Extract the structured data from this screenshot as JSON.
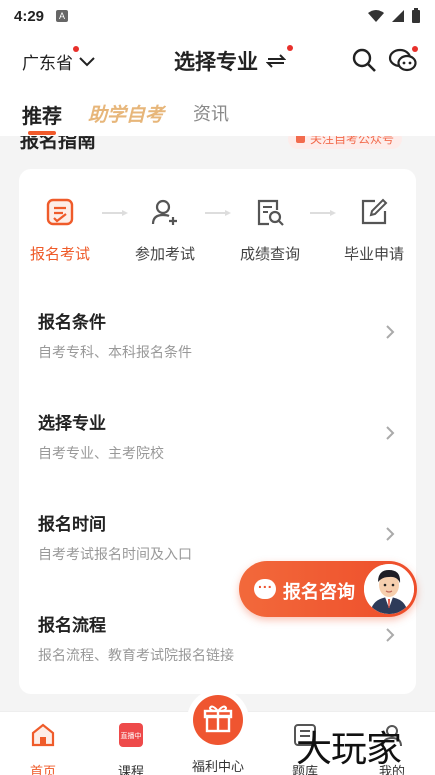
{
  "status_bar": {
    "time": "4:29",
    "badge": "A"
  },
  "header": {
    "province": "广东省",
    "title": "选择专业"
  },
  "tabs": [
    {
      "label": "推荐"
    },
    {
      "label": "助学自考"
    },
    {
      "label": "资讯"
    }
  ],
  "guide": {
    "title": "报名指南",
    "follow_label": "关注自考公众号"
  },
  "steps": [
    {
      "label": "报名考试",
      "icon": "form-check-icon"
    },
    {
      "label": "参加考试",
      "icon": "user-add-icon"
    },
    {
      "label": "成绩查询",
      "icon": "doc-search-icon"
    },
    {
      "label": "毕业申请",
      "icon": "edit-icon"
    }
  ],
  "list": [
    {
      "title": "报名条件",
      "subtitle": "自考专科、本科报名条件"
    },
    {
      "title": "选择专业",
      "subtitle": "自考专业、主考院校"
    },
    {
      "title": "报名时间",
      "subtitle": "自考考试报名时间及入口"
    },
    {
      "title": "报名流程",
      "subtitle": "报名流程、教育考试院报名链接"
    }
  ],
  "fab": {
    "label": "报名咨询"
  },
  "bottom_nav": [
    {
      "label": "首页"
    },
    {
      "label": "课程",
      "badge": "直播中"
    },
    {
      "label": "福利中心"
    },
    {
      "label": "题库"
    },
    {
      "label": "我的"
    }
  ],
  "watermark": "大玩家",
  "colors": {
    "accent": "#ef5b2a",
    "gold": "#e7b67a",
    "background": "#f4f4f4"
  }
}
